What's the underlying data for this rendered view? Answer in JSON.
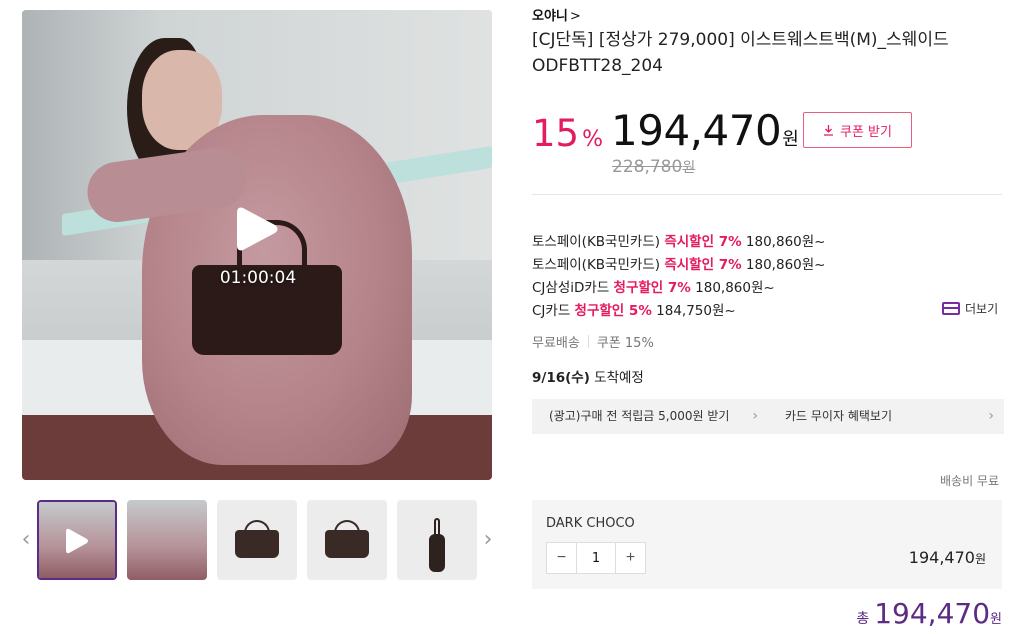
{
  "media": {
    "video_time": "01:00:04",
    "thumbnails": [
      {
        "kind": "video",
        "active": true
      },
      {
        "kind": "model",
        "active": false
      },
      {
        "kind": "bag-front",
        "active": false
      },
      {
        "kind": "bag-angle",
        "active": false
      },
      {
        "kind": "bag-side",
        "active": false
      }
    ]
  },
  "product": {
    "brand": "오야니",
    "brand_chevron": ">",
    "title": "[CJ단독] [정상가 279,000] 이스트웨스트백(M)_스웨이드 ODFBTT28_204",
    "discount": "15",
    "discount_unit": "%",
    "sale_price": "194,470",
    "won": "원",
    "coupon_label": "쿠폰 받기",
    "original_price": "228,780",
    "original_won": "원"
  },
  "card_benefits": [
    {
      "prefix": "토스페이(KB국민카드) ",
      "highlight": "즉시할인 7%",
      "suffix": " 180,860원~"
    },
    {
      "prefix": "토스페이(KB국민카드) ",
      "highlight": "즉시할인 7%",
      "suffix": " 180,860원~"
    },
    {
      "prefix": "CJ삼성iD카드 ",
      "highlight": "청구할인 7%",
      "suffix": " 180,860원~"
    },
    {
      "prefix": "CJ카드 ",
      "highlight": "청구할인 5%",
      "suffix": " 184,750원~"
    }
  ],
  "more_label": "더보기",
  "badges": {
    "shipping": "무료배송",
    "coupon": "쿠폰 15%"
  },
  "arrival": {
    "date": "9/16(수)",
    "label": " 도착예정"
  },
  "promos": [
    {
      "label": "(광고)구매 전 적립금 5,000원 받기"
    },
    {
      "label": "카드 무이자 혜택보기"
    }
  ],
  "shipping_fee": "배송비 무료",
  "option": {
    "name": "DARK CHOCO",
    "quantity": "1",
    "minus": "−",
    "plus": "+",
    "price": "194,470",
    "won": "원"
  },
  "total": {
    "label": "총",
    "amount": "194,470",
    "won": "원"
  },
  "colors": {
    "accent_red": "#e31c5f",
    "accent_purple": "#5b2b86"
  }
}
